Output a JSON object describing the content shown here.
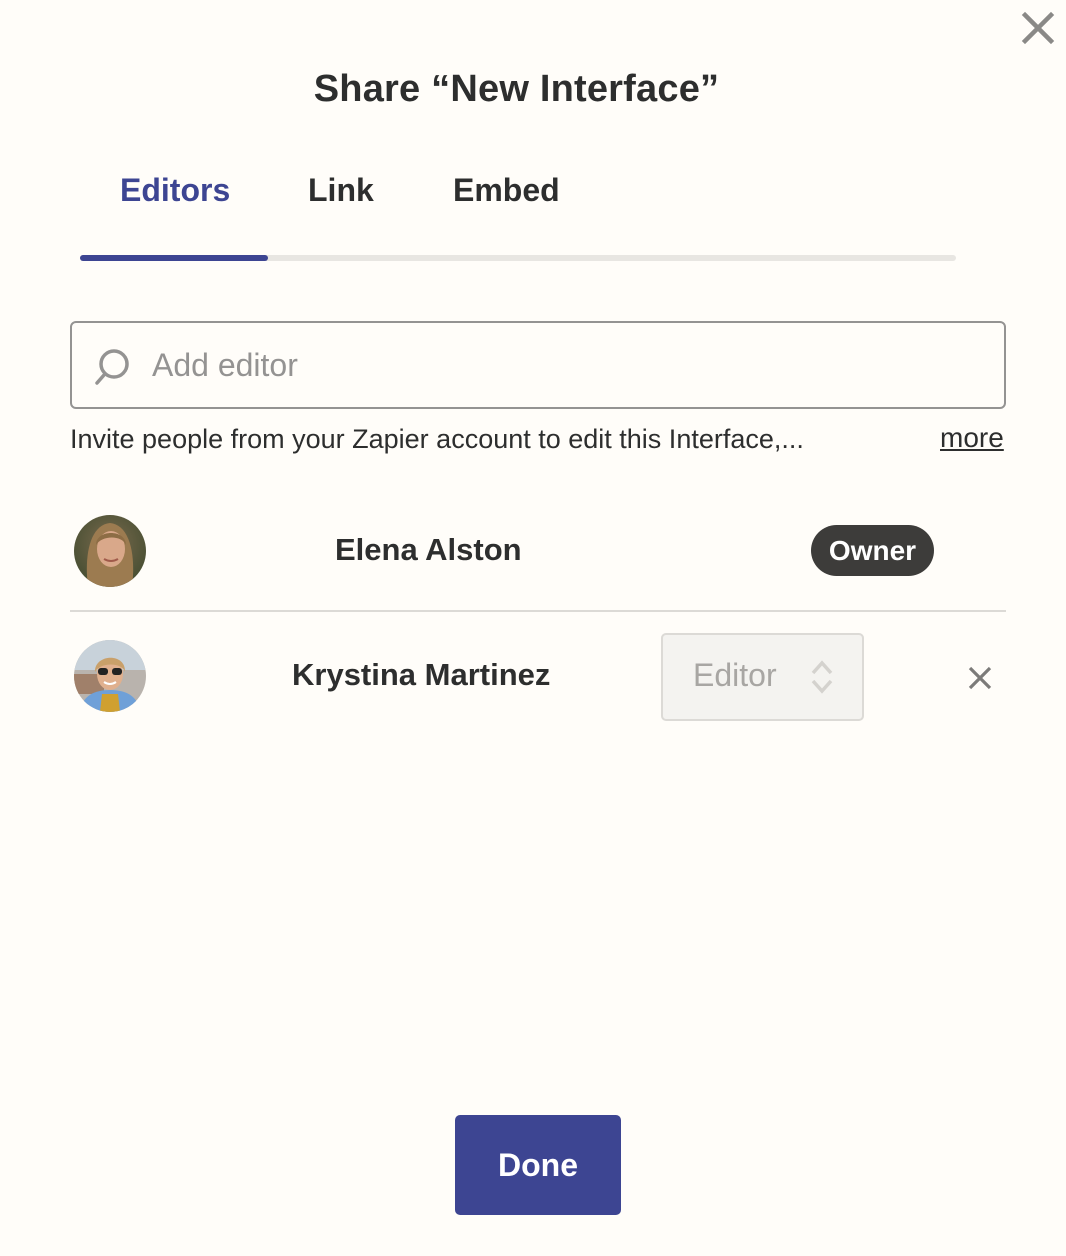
{
  "dialog": {
    "title": "Share “New Interface”",
    "close_icon": "close-icon"
  },
  "tabs": [
    {
      "label": "Editors",
      "active": true
    },
    {
      "label": "Link",
      "active": false
    },
    {
      "label": "Embed",
      "active": false
    }
  ],
  "search": {
    "placeholder": "Add editor",
    "value": "",
    "icon": "search-icon"
  },
  "hint": {
    "text": "Invite people from your Zapier account to edit this Interface,...",
    "more_label": "more"
  },
  "members": [
    {
      "name": "Elena Alston",
      "role": "Owner",
      "role_type": "badge"
    },
    {
      "name": "Krystina Martinez",
      "role": "Editor",
      "role_type": "select",
      "removable": true
    }
  ],
  "footer": {
    "done_label": "Done"
  },
  "colors": {
    "accent": "#3d4592",
    "text": "#2d2e2e",
    "background": "#fffdf9",
    "owner_badge": "#3d3c3a",
    "muted": "#949392"
  }
}
